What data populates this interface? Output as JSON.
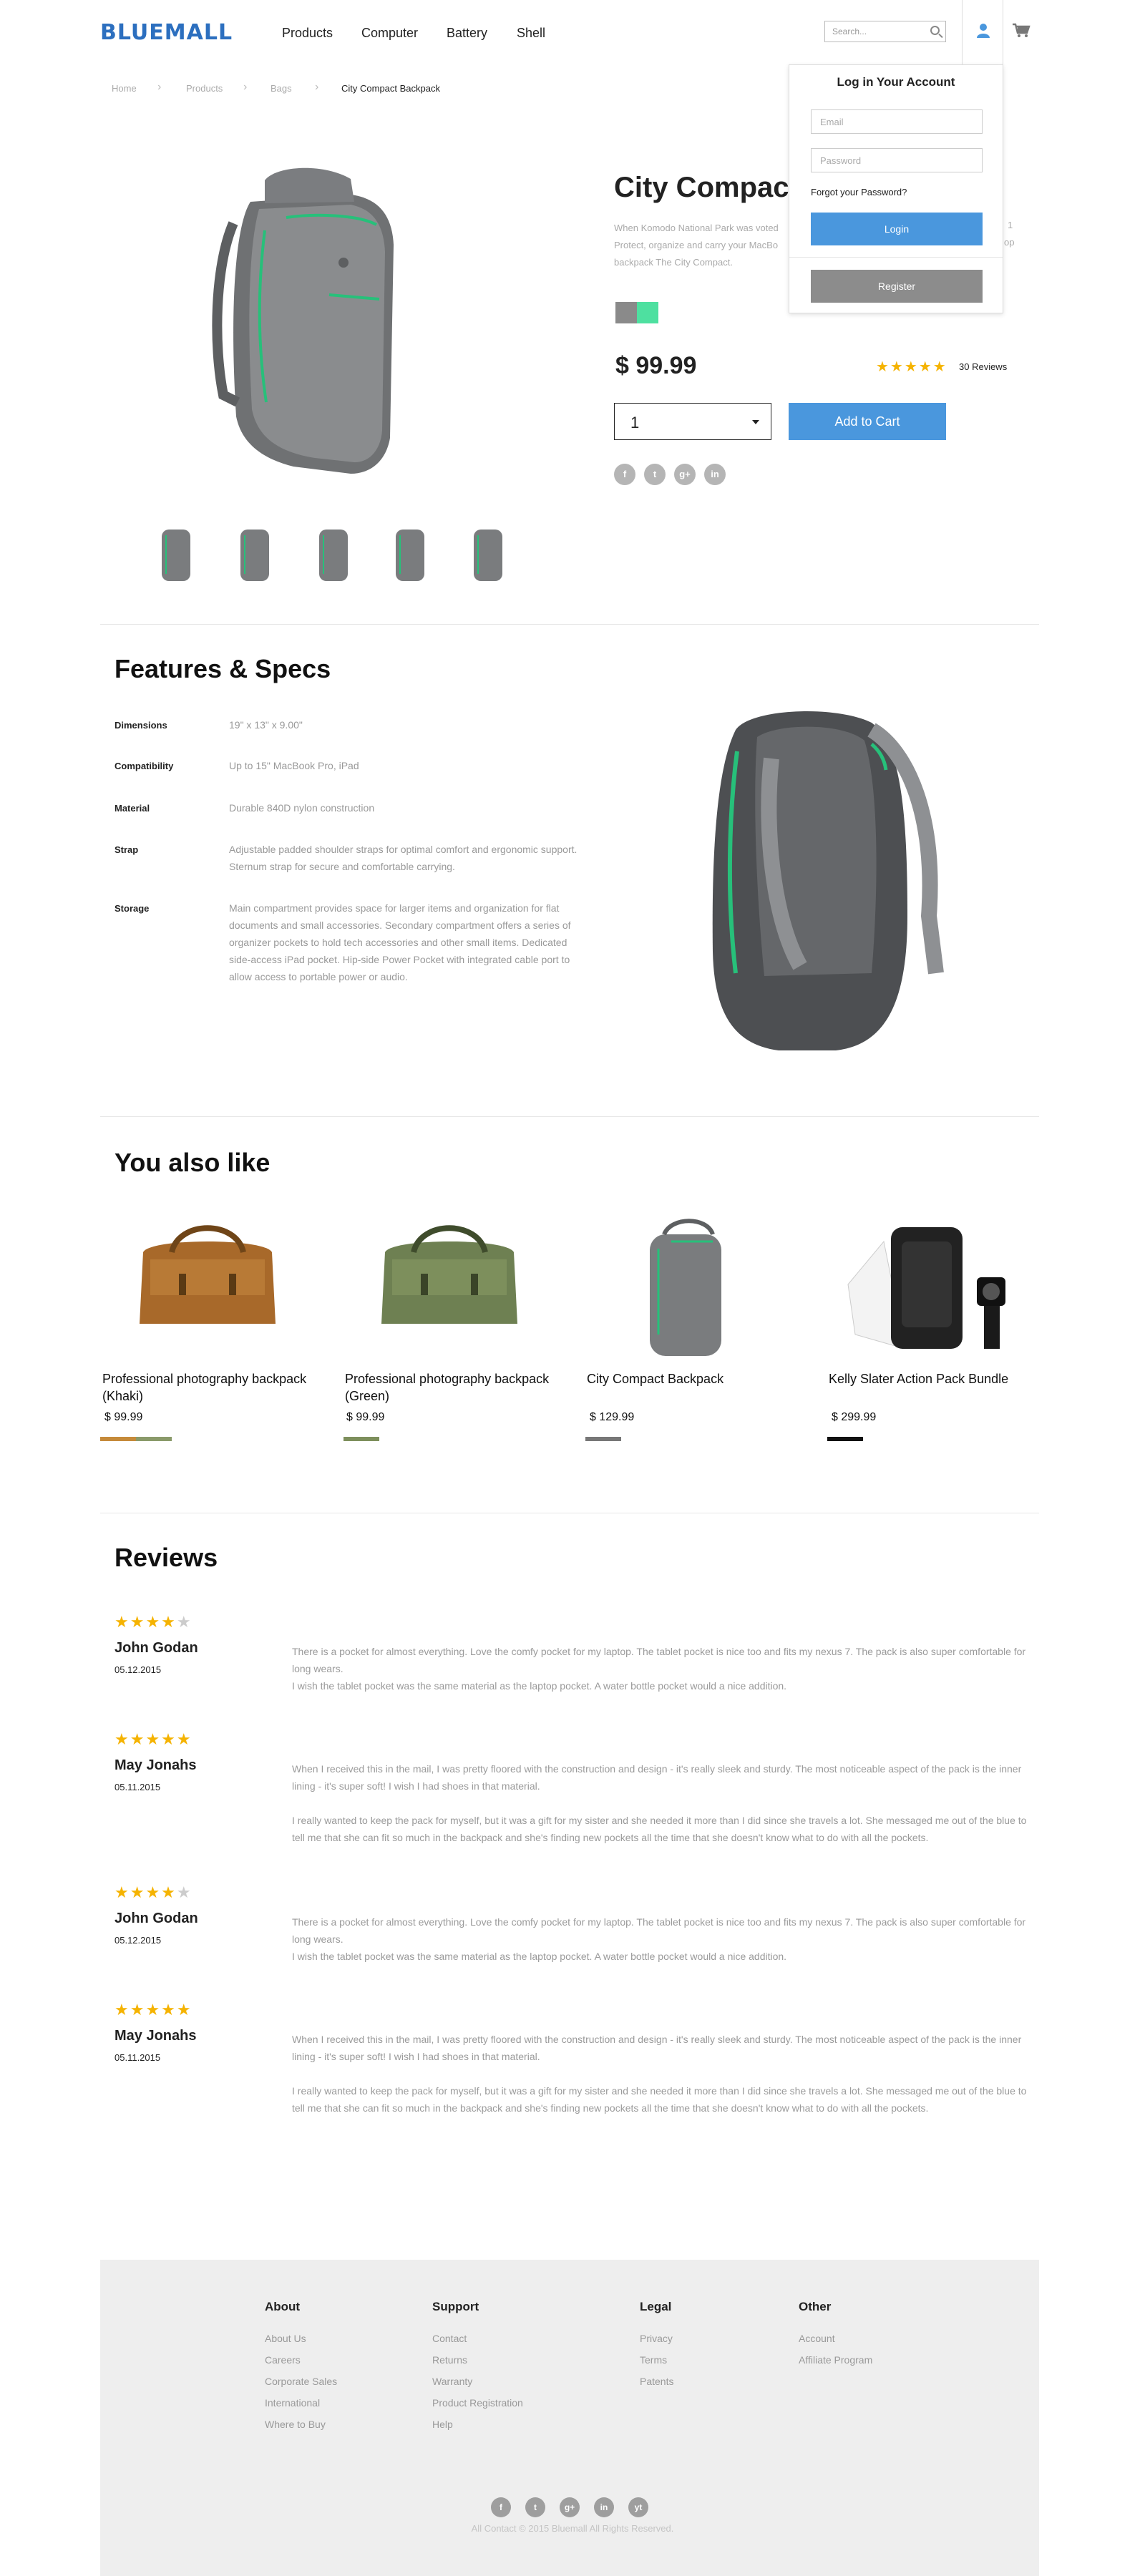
{
  "header": {
    "logo": "BLUEMALL",
    "nav": [
      "Products",
      "Computer",
      "Battery",
      "Shell"
    ],
    "search_placeholder": "Search..."
  },
  "login": {
    "title": "Log in Your Account",
    "email_placeholder": "Email",
    "password_placeholder": "Password",
    "forgot": "Forgot your Password?",
    "login_label": "Login",
    "register_label": "Register"
  },
  "breadcrumb": [
    "Home",
    "Products",
    "Bags",
    "City Compact Backpack"
  ],
  "product": {
    "title": "City Compact",
    "description": [
      "When Komodo National Park was voted",
      "Protect, organize and carry your MacBo",
      "backpack The City Compact."
    ],
    "description_right": [
      "1",
      "op"
    ],
    "swatches": [
      "#8a8a8a",
      "#4ee0a0"
    ],
    "price": "$ 99.99",
    "rating_stars": "★★★★★",
    "reviews": "30 Reviews",
    "quantity": "1",
    "add_to_cart": "Add to Cart",
    "social": [
      "f",
      "t",
      "g+",
      "in"
    ]
  },
  "features": {
    "title": "Features & Specs",
    "specs": [
      {
        "key": "Dimensions",
        "value": [
          "19\" x 13\" x 9.00\""
        ]
      },
      {
        "key": "Compatibility",
        "value": [
          "Up to 15\" MacBook Pro, iPad"
        ]
      },
      {
        "key": "Material",
        "value": [
          "Durable 840D nylon construction"
        ]
      },
      {
        "key": "Strap",
        "value": [
          "Adjustable padded shoulder straps for optimal comfort and ergonomic support.",
          "Sternum strap for secure and comfortable carrying."
        ]
      },
      {
        "key": "Storage",
        "value": [
          "Main compartment provides space for larger items and organization for flat",
          "documents and small accessories. Secondary compartment offers a series of",
          "organizer pockets to hold tech accessories and other small items. Dedicated",
          "side-access iPad pocket. Hip-side Power Pocket with integrated cable port to",
          "allow access to portable power or audio."
        ]
      }
    ]
  },
  "also_like": {
    "title": "You also like",
    "items": [
      {
        "title": [
          "Professional photography backpack",
          "(Khaki)"
        ],
        "price": "$ 99.99",
        "bar": "#c58a3a",
        "bar2": "#8a9a6a"
      },
      {
        "title": [
          "Professional photography backpack",
          "(Green)"
        ],
        "price": "$ 99.99",
        "bar": "#7d8f5c",
        "bar2": ""
      },
      {
        "title": [
          "City  Compact  Backpack",
          ""
        ],
        "price": "$ 129.99",
        "bar": "#777777",
        "bar2": ""
      },
      {
        "title": [
          "Kelly Slater Action Pack Bundle",
          ""
        ],
        "price": "$ 299.99",
        "bar": "#111111",
        "bar2": ""
      }
    ]
  },
  "reviews": {
    "title": "Reviews",
    "items": [
      {
        "stars": "★★★★",
        "empty": "★",
        "name": "John Godan",
        "date": "05.12.2015",
        "text": [
          "There is a pocket for almost everything. Love the comfy pocket for my laptop. The tablet pocket is nice too and fits my nexus 7. The pack is also super comfortable for",
          "long wears.",
          "I wish the tablet pocket was the same material as the laptop pocket. A water bottle pocket would a nice addition."
        ],
        "text2": []
      },
      {
        "stars": "★★★★★",
        "empty": "",
        "name": "May Jonahs",
        "date": "05.11.2015",
        "text": [
          "When I received this in the mail, I was pretty floored with the construction and design - it's really sleek and sturdy. The most noticeable aspect of the pack is the inner",
          "lining - it's super soft! I wish I had shoes in that material."
        ],
        "text2": [
          "I really wanted to keep the pack for myself, but it was a gift for my sister and she needed it more than I did since she travels a lot. She messaged me out of the blue to",
          "tell me that she can fit so much in the backpack and she's finding new pockets all the time that she doesn't know what to do with all the pockets."
        ]
      },
      {
        "stars": "★★★★",
        "empty": "★",
        "name": "John Godan",
        "date": "05.12.2015",
        "text": [
          "There is a pocket for almost everything. Love the comfy pocket for my laptop. The tablet pocket is nice too and fits my nexus 7. The pack is also super comfortable for",
          "long wears.",
          "I wish the tablet pocket was the same material as the laptop pocket. A water bottle pocket would a nice addition."
        ],
        "text2": []
      },
      {
        "stars": "★★★★★",
        "empty": "",
        "name": "May Jonahs",
        "date": "05.11.2015",
        "text": [
          "When I received this in the mail, I was pretty floored with the construction and design - it's really sleek and sturdy. The most noticeable aspect of the pack is the inner",
          "lining - it's super soft! I wish I had shoes in that material."
        ],
        "text2": [
          "I really wanted to keep the pack for myself, but it was a gift for my sister and she needed it more than I did since she travels a lot. She messaged me out of the blue to",
          "tell me that she can fit so much in the backpack and she's finding new pockets all the time that she doesn't know what to do with all the pockets."
        ]
      }
    ]
  },
  "footer": {
    "columns": [
      {
        "head": "About",
        "links": [
          "About Us",
          "Careers",
          "Corporate Sales",
          "International",
          "Where to Buy"
        ]
      },
      {
        "head": "Support",
        "links": [
          "Contact",
          "Returns",
          "Warranty",
          "Product Registration",
          "Help"
        ]
      },
      {
        "head": "Legal",
        "links": [
          "Privacy",
          "Terms",
          "Patents"
        ]
      },
      {
        "head": "Other",
        "links": [
          "Account",
          "Affiliate Program"
        ]
      }
    ],
    "social": [
      "f",
      "t",
      "g+",
      "in",
      "yt"
    ],
    "copyright": "All Contact © 2015 Bluemall All Rights Reserved."
  },
  "colors": {
    "accent": "#4a97dd",
    "star": "#f5b301",
    "green": "#27c07a"
  }
}
